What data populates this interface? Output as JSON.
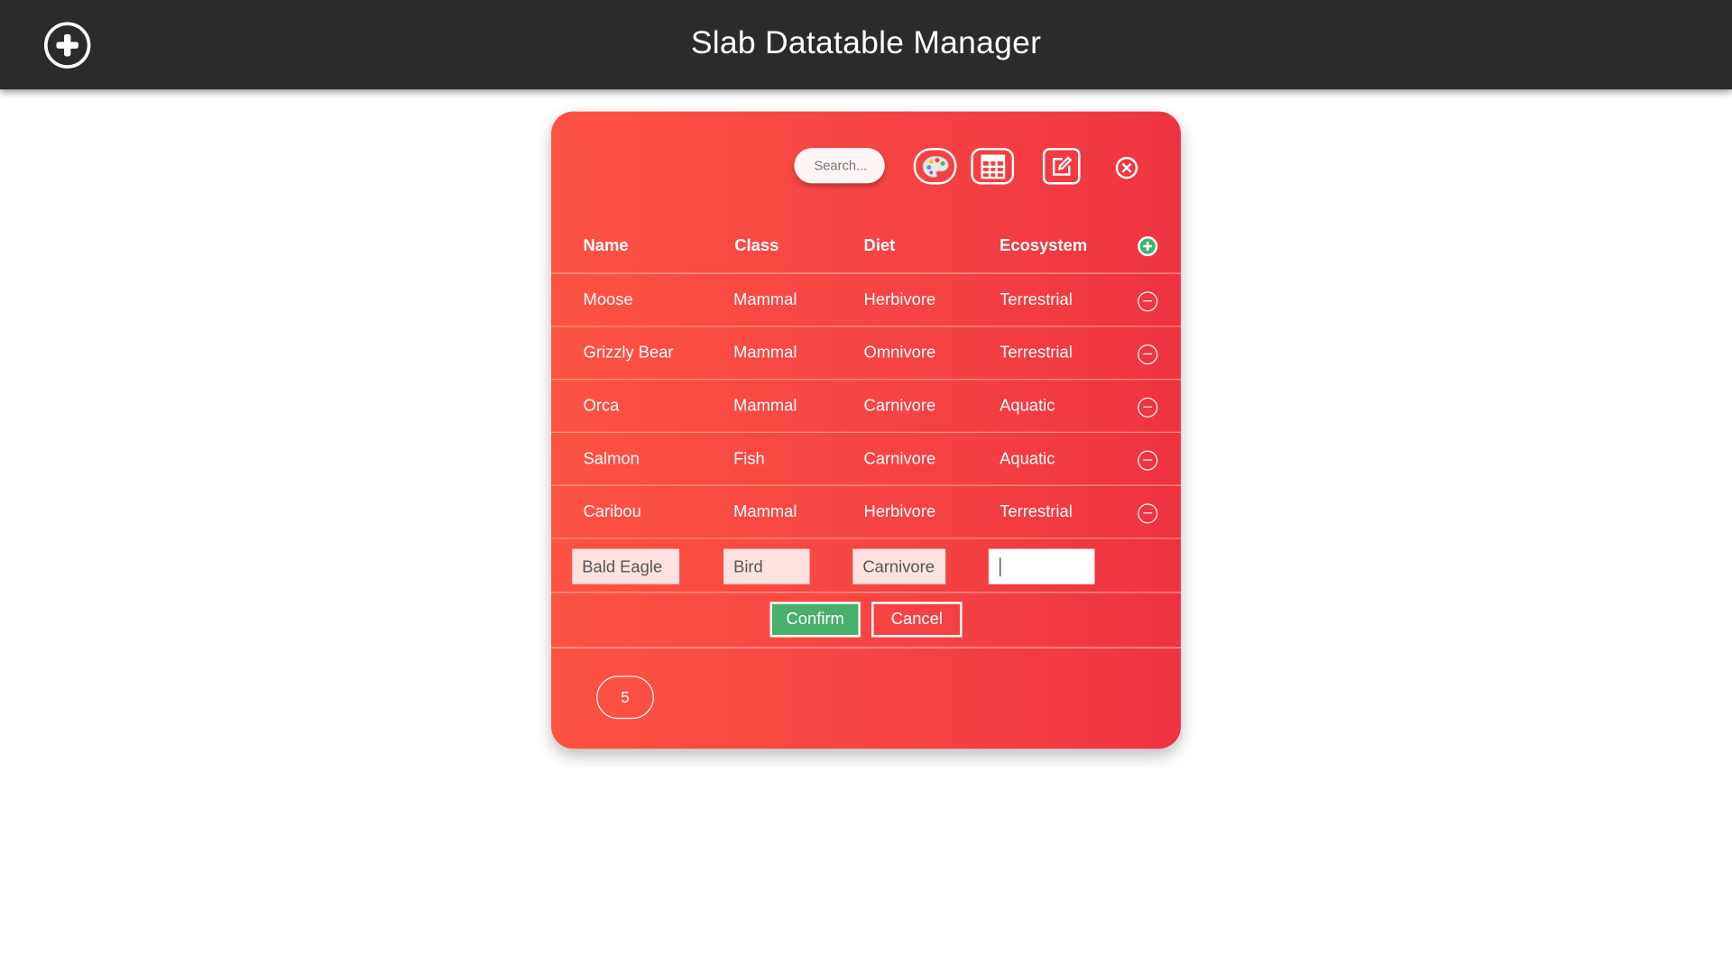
{
  "header": {
    "title": "Slab Datatable Manager"
  },
  "toolbar": {
    "search_placeholder": "Search...",
    "search_value": "",
    "icons": [
      "palette-icon",
      "grid-icon",
      "edit-icon",
      "close-icon"
    ]
  },
  "table": {
    "columns": [
      "Name",
      "Class",
      "Diet",
      "Ecosystem"
    ],
    "rows": [
      [
        "Moose",
        "Mammal",
        "Herbivore",
        "Terrestrial"
      ],
      [
        "Grizzly Bear",
        "Mammal",
        "Omnivore",
        "Terrestrial"
      ],
      [
        "Orca",
        "Mammal",
        "Carnivore",
        "Aquatic"
      ],
      [
        "Salmon",
        "Fish",
        "Carnivore",
        "Aquatic"
      ],
      [
        "Caribou",
        "Mammal",
        "Herbivore",
        "Terrestrial"
      ]
    ],
    "new_row": {
      "name": "Bald Eagle",
      "class": "Bird",
      "diet": "Carnivore",
      "ecosystem": ""
    }
  },
  "actions": {
    "confirm_label": "Confirm",
    "cancel_label": "Cancel"
  },
  "pagination": {
    "page_size": "5"
  },
  "colors": {
    "topbar": "#2b2b2b",
    "card_gradient_start": "#fd5342",
    "card_gradient_end": "#ee3342",
    "confirm_green": "#48b06a",
    "add_green": "#3eb56b"
  }
}
